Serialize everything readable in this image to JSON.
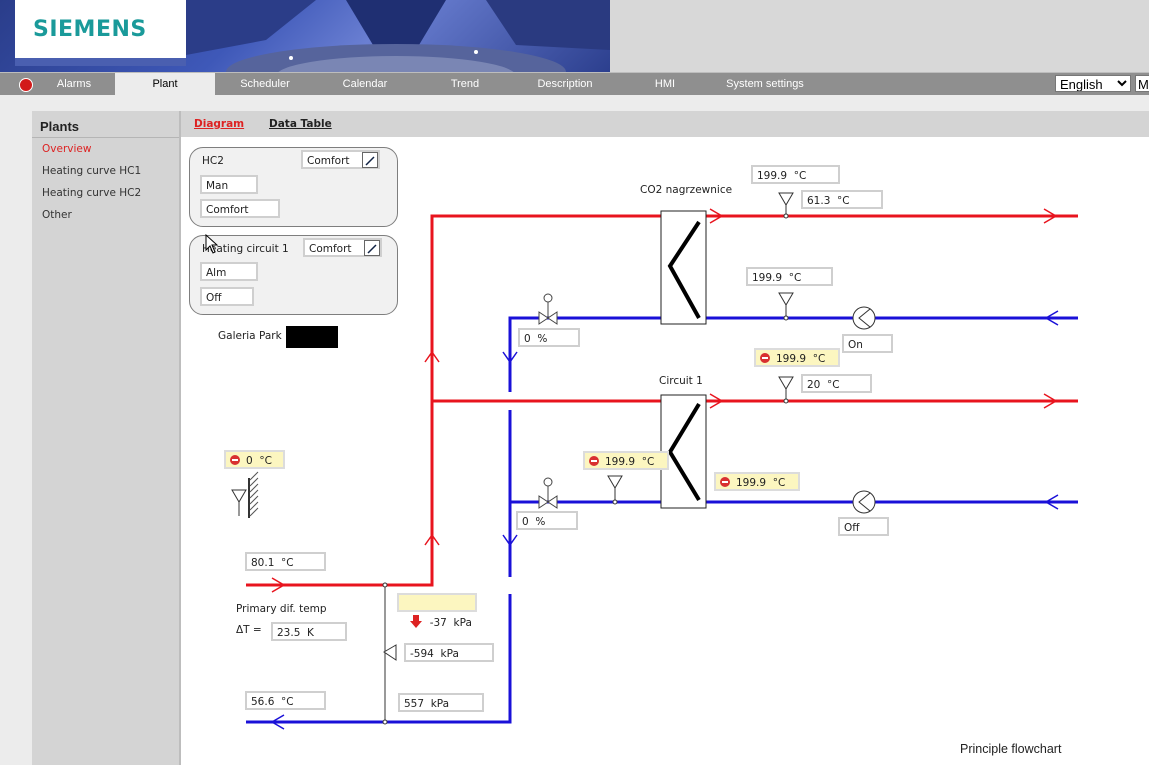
{
  "header": {
    "logo": "SIEMENS"
  },
  "nav": {
    "items": [
      "Alarms",
      "Plant",
      "Scheduler",
      "Calendar",
      "Trend",
      "Description",
      "HMI",
      "System settings"
    ],
    "language": "English",
    "extra": "M"
  },
  "sidebar": {
    "title": "Plants",
    "items": [
      "Overview",
      "Heating curve HC1",
      "Heating curve HC2",
      "Other"
    ]
  },
  "tabs": {
    "diagram": "Diagram",
    "data_table": "Data Table"
  },
  "hc2_panel": {
    "title": "HC2",
    "mode": "Comfort",
    "field1": "Man",
    "field2": "Comfort"
  },
  "hc1_panel": {
    "title": "Heating circuit 1",
    "mode": "Comfort",
    "field1": "Alm",
    "field2": "Off"
  },
  "site_label": "Galeria Park",
  "co2": {
    "label": "CO2 nagrzewnice",
    "supply_setpoint": "199.9  °C",
    "supply_temp": "61.3  °C",
    "return_temp": "199.9  °C",
    "valve": "0  %",
    "pump": "On"
  },
  "circuit1": {
    "label": "Circuit 1",
    "alarm_temp": "199.9  °C",
    "supply_temp": "20  °C",
    "valve_alarm_temp": "199.9  °C",
    "return_alarm_temp": "199.9  °C",
    "valve": "0  %",
    "pump": "Off"
  },
  "outdoor": {
    "temp": "0  °C"
  },
  "primary": {
    "supply_temp": "80.1  °C",
    "return_temp": "56.6  °C",
    "dif_label": "Primary dif. temp",
    "delta_label": "ΔT =",
    "delta_value": "23.5  K",
    "pressure_alarm": "-37  kPa",
    "pressure_diff": "-594  kPa",
    "pressure": "557  kPa"
  },
  "footer": {
    "caption": "Principle flowchart"
  },
  "colors": {
    "supply": "#e8141e",
    "return": "#1a10d8",
    "alarm_bg": "#fcf6c0",
    "active_side": "#dd2222"
  }
}
